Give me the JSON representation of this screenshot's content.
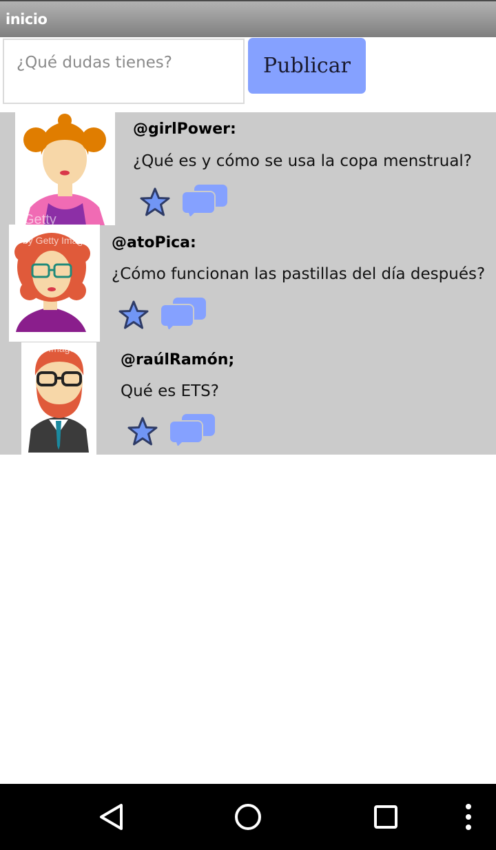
{
  "app": {
    "title": "inicio"
  },
  "composer": {
    "placeholder": "¿Qué dudas tienes?",
    "publish_label": "Publicar"
  },
  "posts": [
    {
      "username": "@girlPower:",
      "question": "¿Qué es y cómo se usa la copa menstrual?",
      "avatar": "woman-orange-hair-avatar"
    },
    {
      "username": "@atoPica:",
      "question": "¿Cómo funcionan las pastillas del día después?",
      "avatar": "woman-curly-red-hair-avatar"
    },
    {
      "username": "@raúlRamón;",
      "question": "Qué es ETS?",
      "avatar": "man-red-beard-avatar"
    }
  ],
  "colors": {
    "accent": "#85a1ff",
    "feed_background": "#cbcbcb",
    "star_fill": "#7196f5"
  },
  "navbar": {
    "keys": [
      "back-icon",
      "home-icon",
      "recents-icon",
      "more-icon"
    ]
  }
}
